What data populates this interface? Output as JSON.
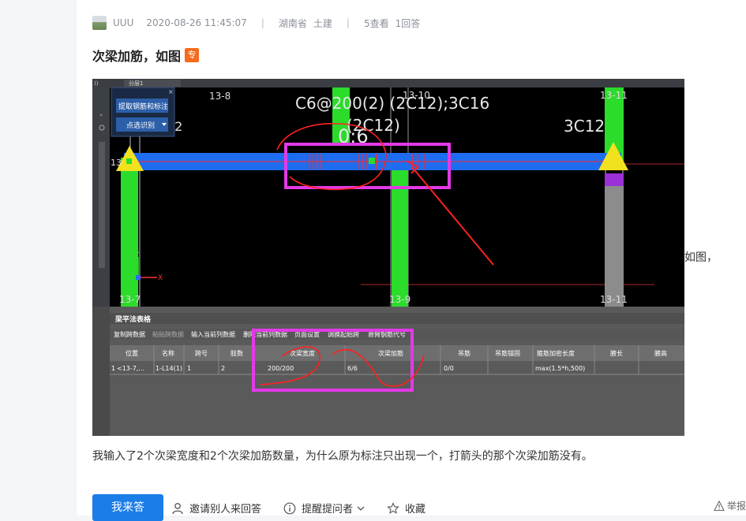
{
  "post": {
    "user": "UUU",
    "datetime": "2020-08-26 11:45:07",
    "separator": "|",
    "region": "湖南省",
    "category": "土建",
    "views": "5查看",
    "answers": "1回答",
    "title": "次梁加筋，如图",
    "badge": "专",
    "tail_text": "如图，",
    "body": "我输入了2个次梁宽度和2个次梁加筋数量，为什么原为标注只出现一个，打箭头的那个次梁加筋没有。"
  },
  "screenshot": {
    "topbar_left": "))",
    "layer_label": "分层1",
    "panel_button": "提取钢筋和标注",
    "panel_select": "点选识别",
    "axis_labels": [
      "13-8",
      "13-10",
      "13-11",
      "13-7",
      "13-9",
      "13-11",
      "13",
      "12"
    ],
    "annotation_main": "C6@200(2) (2C12);3C16",
    "annotation_sub": "(2C12)",
    "annotation_06": "0;6",
    "annotation_3c12": "3C12",
    "ucs_x": "X",
    "ucs_y": "Y",
    "table_title": "梁平法表格",
    "toolbar": [
      "复制跨数据",
      "粘贴跨数据",
      "输入当前列数据",
      "删除当前列数据",
      "页面设置",
      "调换起始跨",
      "悬臂钢筋代号"
    ],
    "headers": [
      "位置",
      "名称",
      "跨号",
      "肢数",
      "次梁宽度",
      "次梁加筋",
      "吊筋",
      "吊筋锚固",
      "箍筋加密长度",
      "腋长",
      "腋高"
    ],
    "row": [
      "1",
      "<13-7,...",
      "1-L14(1)",
      "1",
      "2",
      "200/200",
      "6/6",
      "0/0",
      "",
      "max(1.5*h,500)",
      "",
      ""
    ]
  },
  "actions": {
    "answer": "我来答",
    "invite": "邀请别人来回答",
    "remind": "提醒提问者",
    "favorite": "收藏",
    "report": "举报"
  },
  "colors": {
    "accent": "#1a7de8",
    "badge": "#f66b1c",
    "beam": "#1e6cf0",
    "column": "#2bdc2b",
    "highlight": "#e23ae6",
    "annotation_red": "#ff2020"
  }
}
